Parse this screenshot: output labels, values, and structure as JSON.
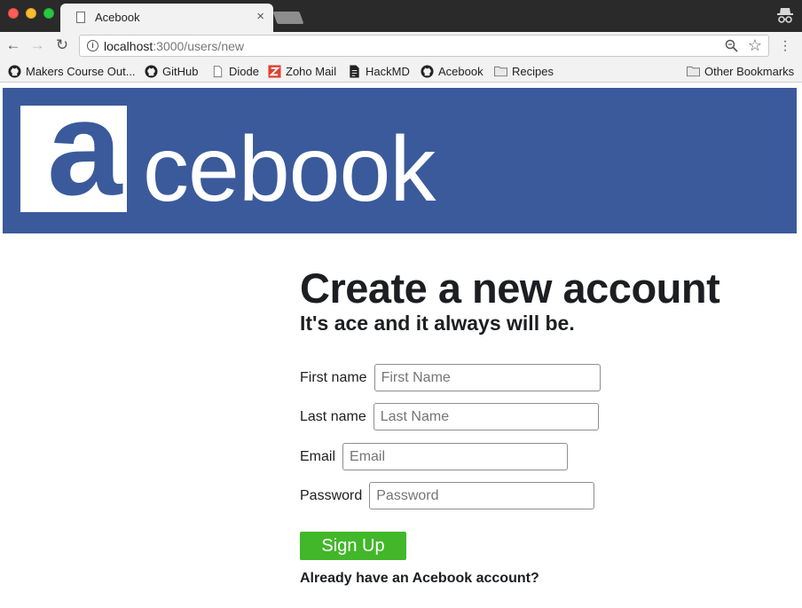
{
  "browser": {
    "tab_title": "Acebook",
    "tab_close": "×",
    "url_host": "localhost",
    "url_rest": ":3000/users/new",
    "bookmarks": [
      {
        "label": "Makers Course Out...",
        "icon": "github-icon"
      },
      {
        "label": "GitHub",
        "icon": "github-icon"
      },
      {
        "label": "Diode",
        "icon": "page-icon"
      },
      {
        "label": "Zoho Mail",
        "icon": "zoho-icon"
      },
      {
        "label": "HackMD",
        "icon": "document-icon"
      },
      {
        "label": "Acebook",
        "icon": "github-icon"
      },
      {
        "label": "Recipes",
        "icon": "folder-icon"
      }
    ],
    "other_bookmarks": "Other Bookmarks"
  },
  "brand": {
    "logo_letter": "a",
    "word": "cebook",
    "color": "#3b5a9b"
  },
  "form": {
    "heading": "Create a new account",
    "subheading": "It's ace and it always will be.",
    "fields": [
      {
        "label": "First name",
        "placeholder": "First Name"
      },
      {
        "label": "Last name",
        "placeholder": "Last Name"
      },
      {
        "label": "Email",
        "placeholder": "Email"
      },
      {
        "label": "Password",
        "placeholder": "Password"
      }
    ],
    "submit_label": "Sign Up",
    "submit_color": "#42b72a",
    "login_prompt": "Already have an Acebook account?"
  }
}
